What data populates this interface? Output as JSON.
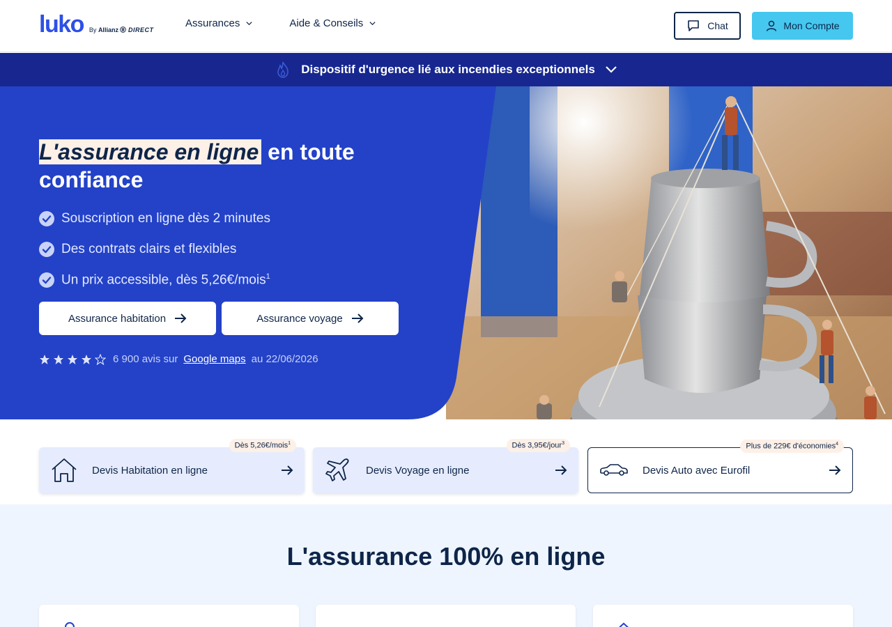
{
  "header": {
    "logo": {
      "word": "luko",
      "by": "By",
      "brand1": "Allianz",
      "brand2": "DIRECT"
    },
    "nav": [
      {
        "label": "Assurances"
      },
      {
        "label": "Aide & Conseils"
      }
    ],
    "chat_label": "Chat",
    "account_label": "Mon Compte"
  },
  "banner": {
    "text": "Dispositif d'urgence lié aux incendies exceptionnels"
  },
  "hero": {
    "title_highlight": "L'assurance en ligne",
    "title_rest": " en toute confiance",
    "bullets": [
      {
        "text": "Souscription en ligne dès 2 minutes",
        "sup": ""
      },
      {
        "text": "Des contrats clairs et flexibles",
        "sup": ""
      },
      {
        "text": "Un prix accessible, dès 5,26€/mois",
        "sup": "1"
      }
    ],
    "buttons": [
      {
        "label": "Assurance habitation"
      },
      {
        "label": "Assurance voyage"
      }
    ],
    "rating": {
      "stars_filled": 4,
      "stars_total": 5,
      "count_text": "6 900 avis sur",
      "link": "Google maps",
      "date_text": "au 22/06/2026"
    }
  },
  "quotes": [
    {
      "label": "Devis Habitation en ligne",
      "badge": "Dès 5,26€/mois",
      "badge_sup": "1",
      "icon": "house-icon"
    },
    {
      "label": "Devis Voyage en ligne",
      "badge": "Dès 3,95€/jour",
      "badge_sup": "3",
      "icon": "plane-icon"
    },
    {
      "label": "Devis Auto avec Eurofil",
      "badge": "Plus de 229€ d'économies",
      "badge_sup": "4",
      "icon": "car-icon"
    }
  ],
  "section": {
    "title": "L'assurance 100% en ligne"
  },
  "colors": {
    "brand_blue": "#2d50e6",
    "navy": "#0e2549",
    "banner": "#17278f",
    "hero_blue": "#2342c8",
    "account_btn": "#45c7ef",
    "highlight": "#fdf0e7",
    "section_bg": "#eef5fe"
  }
}
